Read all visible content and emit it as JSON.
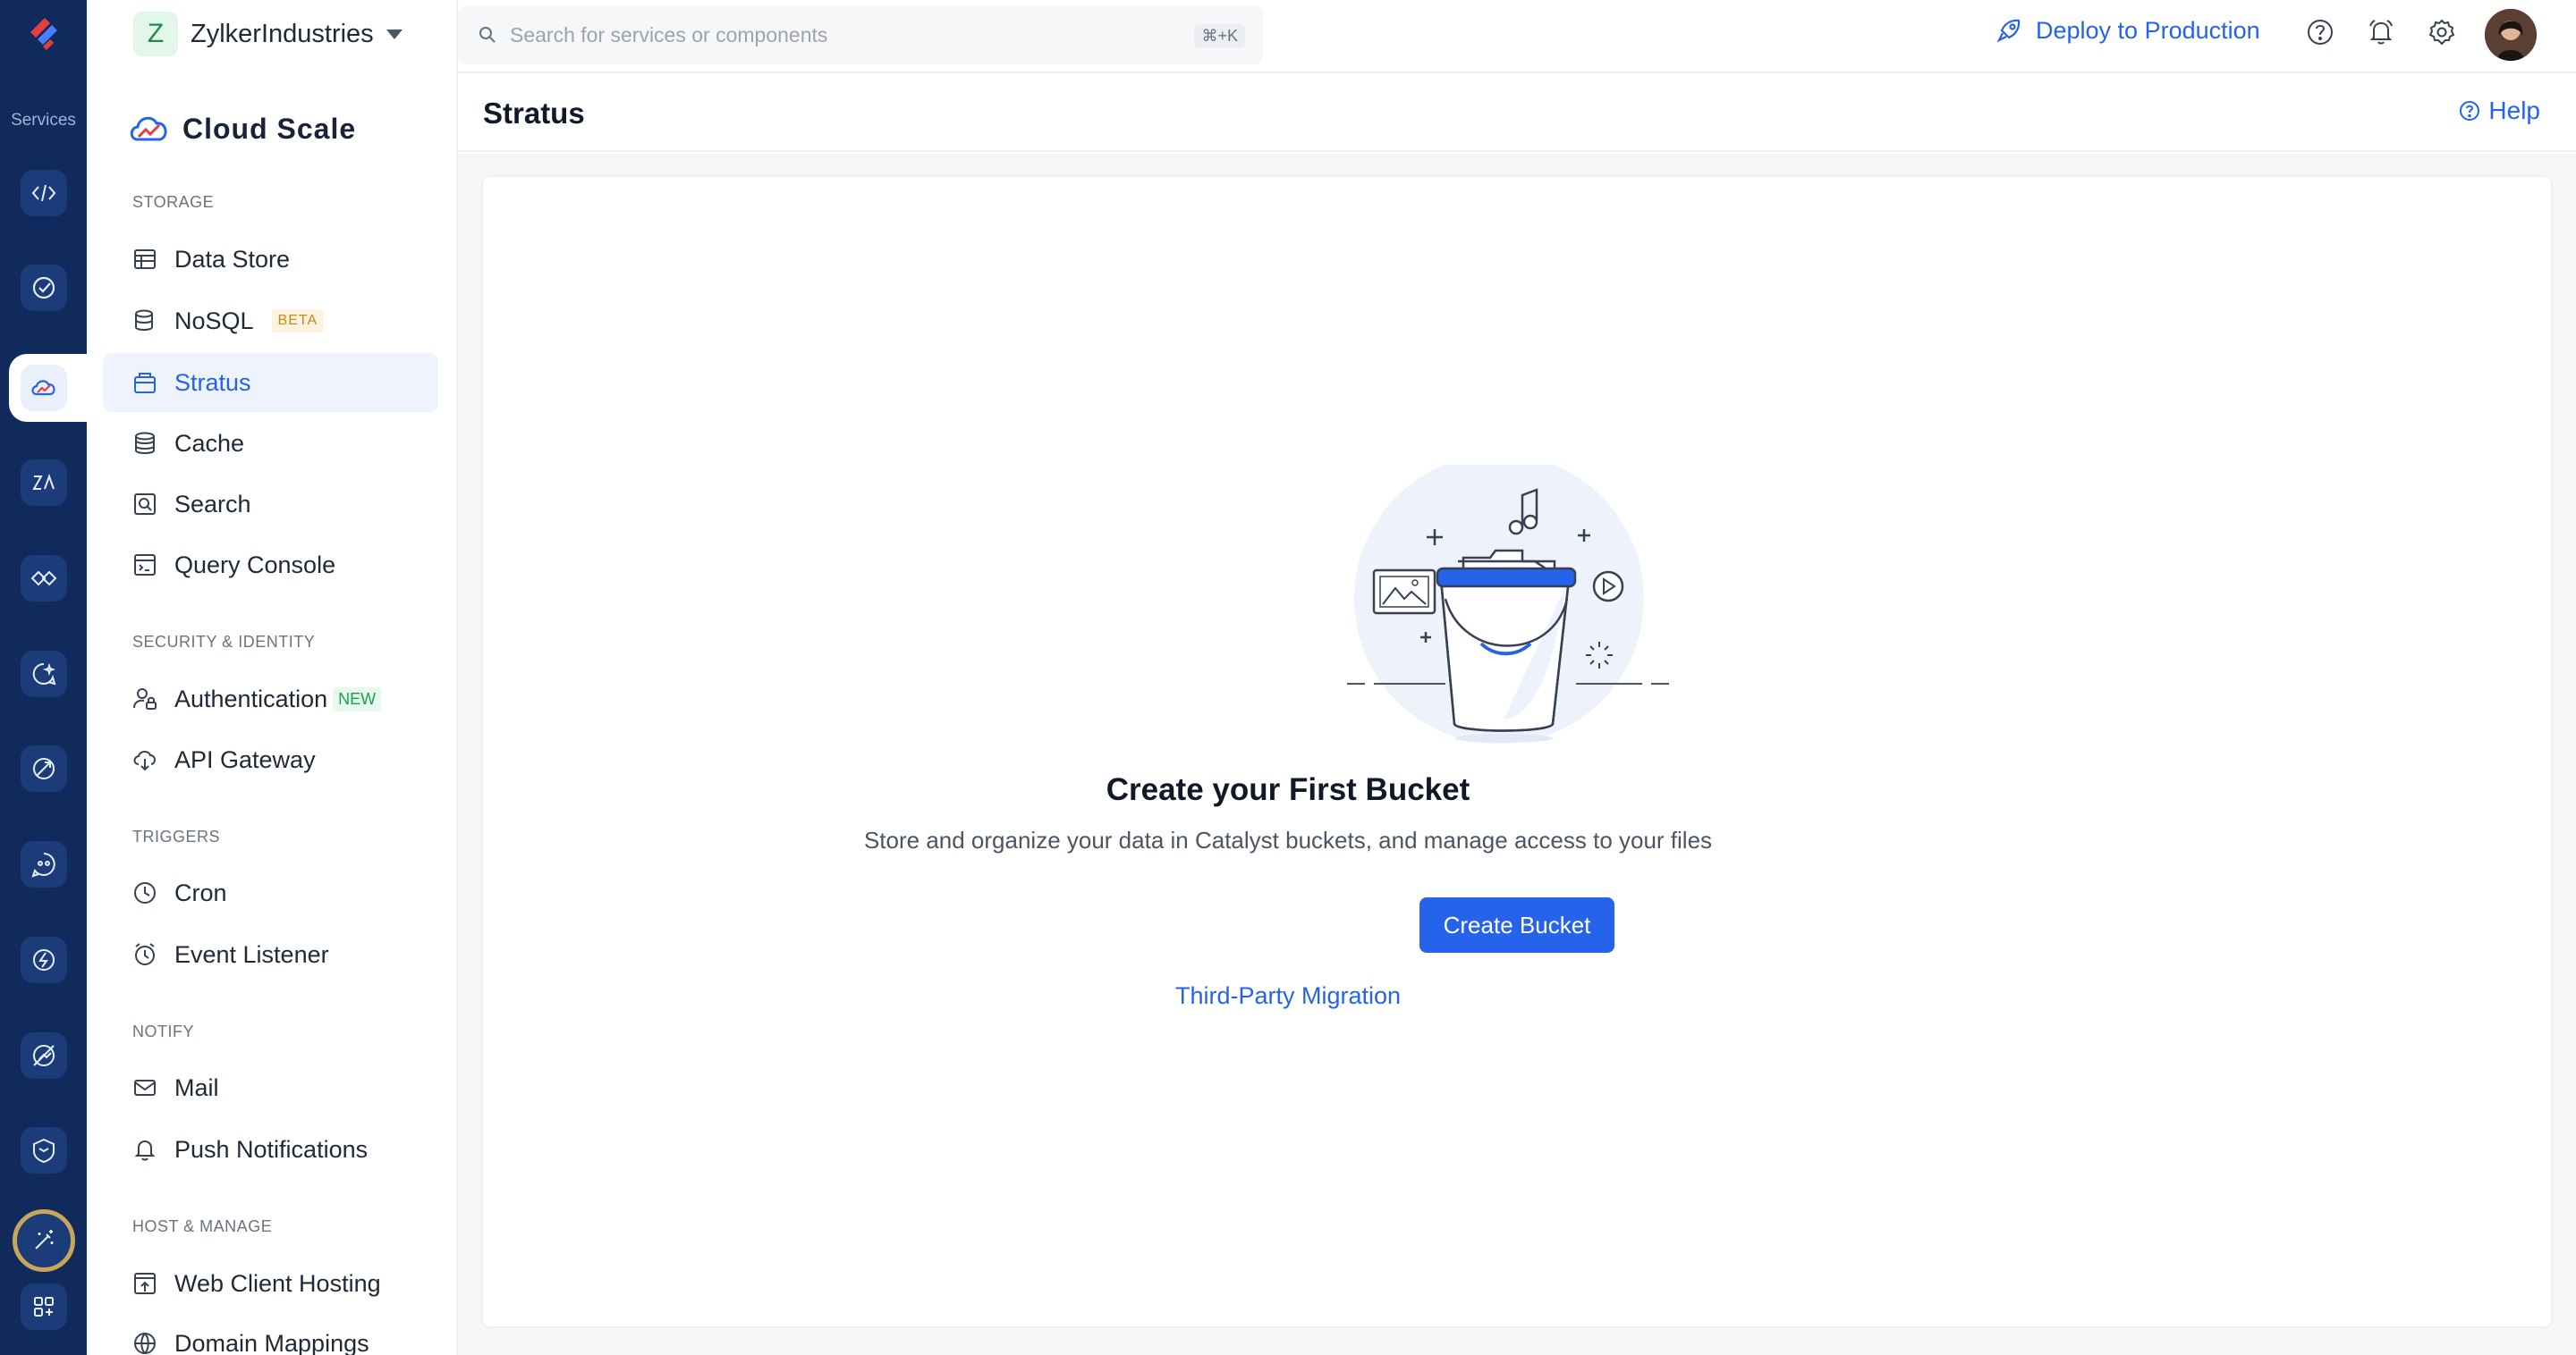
{
  "rail": {
    "services_label": "Services",
    "items": [
      "code-icon",
      "check-circle-icon",
      "cloud-scale-icon",
      "zia-icon",
      "integration-icon",
      "ai-icon",
      "pipeline-icon",
      "smartbrowz-icon",
      "circuit-icon",
      "devops-icon",
      "security-icon"
    ],
    "active": "cloud-scale-icon"
  },
  "org": {
    "initial": "Z",
    "name": "ZylkerIndustries"
  },
  "product": {
    "name": "Cloud Scale"
  },
  "sidebar": {
    "sections": [
      {
        "title": "STORAGE",
        "items": [
          {
            "label": "Data Store",
            "icon": "table-icon"
          },
          {
            "label": "NoSQL",
            "icon": "database-icon",
            "badge": "BETA"
          },
          {
            "label": "Stratus",
            "icon": "bucket-icon",
            "active": true
          },
          {
            "label": "Cache",
            "icon": "cache-icon"
          },
          {
            "label": "Search",
            "icon": "search-box-icon"
          },
          {
            "label": "Query Console",
            "icon": "console-icon"
          }
        ]
      },
      {
        "title": "SECURITY & IDENTITY",
        "items": [
          {
            "label": "Authentication",
            "icon": "user-lock-icon",
            "badge": "NEW"
          },
          {
            "label": "API Gateway",
            "icon": "gateway-icon"
          }
        ]
      },
      {
        "title": "TRIGGERS",
        "items": [
          {
            "label": "Cron",
            "icon": "clock-icon"
          },
          {
            "label": "Event Listener",
            "icon": "alarm-icon"
          }
        ]
      },
      {
        "title": "NOTIFY",
        "items": [
          {
            "label": "Mail",
            "icon": "mail-icon"
          },
          {
            "label": "Push Notifications",
            "icon": "bell-icon"
          }
        ]
      },
      {
        "title": "HOST & MANAGE",
        "items": [
          {
            "label": "Web Client Hosting",
            "icon": "upload-window-icon"
          },
          {
            "label": "Domain Mappings",
            "icon": "globe-icon"
          }
        ]
      }
    ]
  },
  "topbar": {
    "search_placeholder": "Search for services or components",
    "shortcut": "⌘+K",
    "deploy_label": "Deploy to Production"
  },
  "page": {
    "title": "Stratus",
    "help_label": "Help"
  },
  "empty_state": {
    "title": "Create your First Bucket",
    "description": "Store and organize your data in Catalyst buckets, and manage access to your files",
    "primary_button": "Create Bucket",
    "secondary_link": "Third-Party Migration"
  },
  "colors": {
    "rail": "#102a5c",
    "accent": "#2563eb",
    "content_bg": "#f5f6f8"
  }
}
